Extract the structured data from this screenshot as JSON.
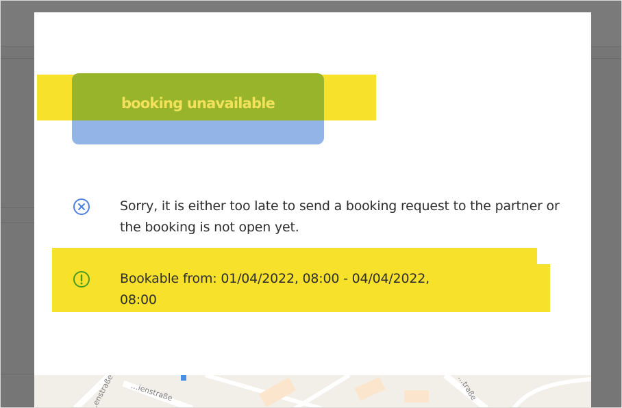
{
  "dialog": {
    "title": "booking unavailable",
    "error_message": "Sorry, it is either too late to send a booking request to the partner or the booking is not open yet.",
    "info_message_line1": "Bookable from: 01/04/2022, 08:00 - 04/04/2022,",
    "info_message_line2": "08:00",
    "error_icon": "circle-x-icon",
    "info_icon": "circle-exclamation-icon"
  },
  "map": {
    "street_labels": [
      "…enstraße",
      "…ienstraße",
      "…traße"
    ]
  },
  "colors": {
    "overlay": "#767676",
    "highlight": "#f7e12a",
    "title_green": "#98b42a",
    "title_blue": "#92b4e6",
    "error_icon": "#4a7fe0",
    "info_icon": "#4a9a22"
  }
}
